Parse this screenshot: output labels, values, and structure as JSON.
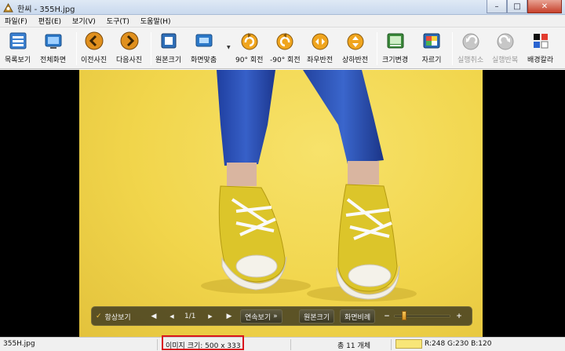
{
  "window": {
    "title": "한씨 - 355H.jpg"
  },
  "menu": [
    "파일(F)",
    "편집(E)",
    "보기(V)",
    "도구(T)",
    "도움말(H)"
  ],
  "toolbar": {
    "list_view": "목록보기",
    "full_screen": "전체화면",
    "prev_photo": "이전사진",
    "next_photo": "다음사진",
    "original_size": "원본크기",
    "fit_screen": "화면맞춤",
    "rotate_90": "90° 회전",
    "rotate_neg90": "-90° 회전",
    "flip_horizontal": "좌우반전",
    "flip_vertical": "상하반전",
    "resize": "크기변경",
    "crop": "자르기",
    "undo": "실행취소",
    "redo": "실행반복",
    "bg_color": "배경칼라"
  },
  "controlbar": {
    "always_show": "항상보기",
    "page": "1/1",
    "slideshow": "연속보기",
    "original_size": "원본크기",
    "fit_ratio": "화면비례"
  },
  "status": {
    "filename": "355H.jpg",
    "image_size": "이미지 크기: 500 x 333",
    "total": "총 11 개체",
    "pixel_color": "R:248 G:230 B:120",
    "pixel_swatch": "#f8e678"
  },
  "colors": {
    "accent_red": "#d9151d",
    "background": "#f1d54b"
  }
}
